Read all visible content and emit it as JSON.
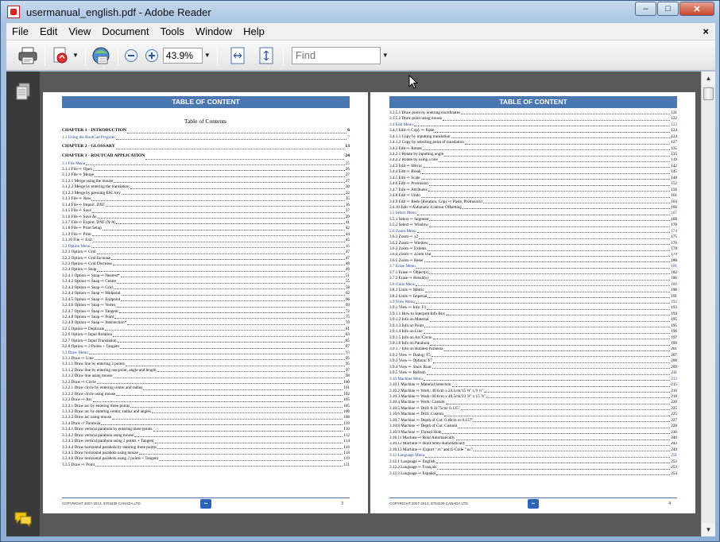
{
  "window": {
    "title": "usermanual_english.pdf - Adobe Reader"
  },
  "menubar": {
    "items": [
      "File",
      "Edit",
      "View",
      "Document",
      "Tools",
      "Window",
      "Help"
    ],
    "close_glyph": "×"
  },
  "window_controls": {
    "minimize": "–",
    "maximize": "□",
    "close": "✕"
  },
  "toolbar": {
    "zoom_value": "43.9%",
    "find_placeholder": "Find",
    "icons": [
      "print-icon",
      "create-pdf-icon",
      "collaborate-icon",
      "zoom-out-icon",
      "zoom-in-icon",
      "fit-page-icon",
      "fit-width-icon"
    ]
  },
  "left_page": {
    "header": "TABLE OF CONTENT",
    "title": "Table of Contents",
    "footer_text": "COPYRIGHT 2007-2013, 9704239 CANADA LTD.",
    "page_number": "3",
    "entries": [
      {
        "t": "CHAPTER 1 - INTRODUCTION",
        "p": "6",
        "k": "chapter"
      },
      {
        "t": "1.1 Using the RoutCad Program",
        "p": "7",
        "k": "sec"
      },
      {
        "t": "CHAPTER 2 - GLOSSARY",
        "p": "13",
        "k": "chapter"
      },
      {
        "t": "CHAPTER 3 - ROUTCAD APPLICATION",
        "p": "24",
        "k": "chapter"
      },
      {
        "t": "3.1 File Menu",
        "p": "25",
        "k": "sec"
      },
      {
        "t": "3.1.1 File ⇨ Open",
        "p": "26",
        "k": ""
      },
      {
        "t": "3.1.2 File ⇨ Merge",
        "p": "27",
        "k": ""
      },
      {
        "t": "3.1.2.1 Merge using the mouse",
        "p": "27",
        "k": ""
      },
      {
        "t": "3.1.2.2 Merge by entering the translation",
        "p": "30",
        "k": ""
      },
      {
        "t": "3.1.2.3 Merge by pressing ESC key",
        "p": "32",
        "k": ""
      },
      {
        "t": "3.1.3 File ⇨ New",
        "p": "35",
        "k": ""
      },
      {
        "t": "3.1.4 File ⇨ Import .DXF",
        "p": "36",
        "k": ""
      },
      {
        "t": "3.1.5 File ⇨ Save",
        "p": "37",
        "k": ""
      },
      {
        "t": "3.1.6 File ⇨ Save As",
        "p": "39",
        "k": ""
      },
      {
        "t": "3.1.7 File ⇨ Export .DXF (N/A)",
        "p": "41",
        "k": ""
      },
      {
        "t": "3.1.8 File ⇨ Print Setup",
        "p": "42",
        "k": ""
      },
      {
        "t": "3.1.9 File ⇨ Print",
        "p": "44",
        "k": ""
      },
      {
        "t": "3.1.10 File ⇨ Exit",
        "p": "45",
        "k": ""
      },
      {
        "t": "3.2 Option Menu",
        "p": "46",
        "k": "sec"
      },
      {
        "t": "3.2.1 Option ⇨ Grid",
        "p": "47",
        "k": ""
      },
      {
        "t": "3.2.2 Option ⇨ Grid Increase",
        "p": "47",
        "k": ""
      },
      {
        "t": "3.2.3 Option ⇨ Grid Decrease",
        "p": "48",
        "k": ""
      },
      {
        "t": "3.2.4 Option ⇨ Snap",
        "p": "49",
        "k": ""
      },
      {
        "t": "3.2.4.1 Option ⇨ Snap ⇨ Nearest*",
        "p": "51",
        "k": ""
      },
      {
        "t": "3.2.4.2 Option ⇨ Snap ⇨ Centre",
        "p": "55",
        "k": ""
      },
      {
        "t": "3.2.4.3 Option ⇨ Snap ⇨ Grid",
        "p": "58",
        "k": ""
      },
      {
        "t": "3.2.4.4 Option ⇨ Snap ⇨ Midpoint",
        "p": "62",
        "k": ""
      },
      {
        "t": "3.2.4.5 Option ⇨ Snap ⇨ Endpoint",
        "p": "66",
        "k": ""
      },
      {
        "t": "3.2.4.6 Option ⇨ Snap ⇨ Vertex",
        "p": "69",
        "k": ""
      },
      {
        "t": "3.2.4.7 Option ⇨ Snap ⇨ Tangent",
        "p": "72",
        "k": ""
      },
      {
        "t": "3.2.4.8 Option ⇨ Snap ⇨ Point",
        "p": "75",
        "k": ""
      },
      {
        "t": "3.2.4.9 Option ⇨ Snap ⇨ Intersection*",
        "p": "78",
        "k": ""
      },
      {
        "t": "3.2.5 Option ⇨ Duplicate",
        "p": "81",
        "k": ""
      },
      {
        "t": "3.2.6 Option ⇨ Input Rotation",
        "p": "83",
        "k": ""
      },
      {
        "t": "3.2.7 Option ⇨ Input Translation",
        "p": "85",
        "k": ""
      },
      {
        "t": "3.2.8 Option ⇨ 2 Points + Tangent",
        "p": "87",
        "k": ""
      },
      {
        "t": "3.3 Draw Menu",
        "p": "93",
        "k": "sec"
      },
      {
        "t": "3.3.1 Draw ⇨ Line",
        "p": "95",
        "k": ""
      },
      {
        "t": "3.3.1.1 Draw line by entering 2 points",
        "p": "95",
        "k": ""
      },
      {
        "t": "3.3.1.2 Draw line by entering one point, angle and length",
        "p": "97",
        "k": ""
      },
      {
        "t": "3.3.1.3 Draw line using mouse",
        "p": "98",
        "k": ""
      },
      {
        "t": "3.3.2 Draw ⇨ Circle",
        "p": "100",
        "k": ""
      },
      {
        "t": "3.3.2.1 Draw circle by entering center and radius",
        "p": "101",
        "k": ""
      },
      {
        "t": "3.3.2.2 Draw circle using mouse",
        "p": "102",
        "k": ""
      },
      {
        "t": "3.3.3 Draw ⇨ Arc",
        "p": "105",
        "k": ""
      },
      {
        "t": "3.3.3.1 Draw arc by entering three points",
        "p": "105",
        "k": ""
      },
      {
        "t": "3.3.3.2 Draw arc by entering center, radius and angles",
        "p": "106",
        "k": ""
      },
      {
        "t": "3.3.3.3 Draw arc using mouse",
        "p": "108",
        "k": ""
      },
      {
        "t": "3.3.4 Draw ⇨ Parabola",
        "p": "110",
        "k": ""
      },
      {
        "t": "3.3.4.1 Draw vertical parabola by entering three points",
        "p": "110",
        "k": ""
      },
      {
        "t": "3.3.4.2 Draw vertical parabola using mouse",
        "p": "112",
        "k": ""
      },
      {
        "t": "3.3.4.3 Draw vertical parabola using 2 points + Tangent",
        "p": "114",
        "k": ""
      },
      {
        "t": "3.3.4.4 Draw horizontal parabola by entering three points",
        "p": "116",
        "k": ""
      },
      {
        "t": "3.3.4.5 Draw horizontal parabola using mouse",
        "p": "118",
        "k": ""
      },
      {
        "t": "3.3.4.6 Draw horizontal parabola using 2 points + Tangent",
        "p": "119",
        "k": ""
      },
      {
        "t": "3.3.5 Draw ⇨ Point",
        "p": "121",
        "k": ""
      }
    ]
  },
  "right_page": {
    "header": "TABLE OF CONTENT",
    "footer_text": "COPYRIGHT 2007-2013, 9704239 CANADA LTD.",
    "page_number": "4",
    "entries": [
      {
        "t": "3.3.5.1 Draw point by entering coordinates",
        "p": "121",
        "k": ""
      },
      {
        "t": "3.3.5.2 Draw point using mouse",
        "p": "122",
        "k": ""
      },
      {
        "t": "3.4 Edit Menu",
        "p": "123",
        "k": "sec"
      },
      {
        "t": "3.4.1 Edit ⇨ Copy ⇨ Paste",
        "p": "124",
        "k": ""
      },
      {
        "t": "3.4.1.1 Copy by inputting translation",
        "p": "124",
        "k": ""
      },
      {
        "t": "3.4.1.2 Copy by selecting point of translation",
        "p": "127",
        "k": ""
      },
      {
        "t": "3.4.2 Edit ⇨ Rotate",
        "p": "135",
        "k": ""
      },
      {
        "t": "3.4.2.1 Rotate by inputting angle",
        "p": "135",
        "k": ""
      },
      {
        "t": "3.4.2.2 Rotate by using a line",
        "p": "139",
        "k": ""
      },
      {
        "t": "3.4.3 Edit ⇨ Mirror",
        "p": "142",
        "k": ""
      },
      {
        "t": "3.4.4 Edit ⇨ Break",
        "p": "145",
        "k": ""
      },
      {
        "t": "3.4.5 Edit ⇨ Scale",
        "p": "148",
        "k": ""
      },
      {
        "t": "3.4.6 Edit ⇨ Protrusion",
        "p": "152",
        "k": ""
      },
      {
        "t": "3.4.7 Edit ⇨ Attributes",
        "p": "156",
        "k": ""
      },
      {
        "t": "3.4.8 Edit ⇨ Undo",
        "p": "161",
        "k": ""
      },
      {
        "t": "3.4.9 Edit ⇨ Redo (Rotation, Copy ⇨ Paste, Protrusion)",
        "p": "163",
        "k": ""
      },
      {
        "t": "3.4.10 Edit ⇨Automatic Contour Offsetting",
        "p": "166",
        "k": ""
      },
      {
        "t": "3.5 Select Menu",
        "p": "167",
        "k": "sec"
      },
      {
        "t": "3.5.1 Select ⇨ Segment",
        "p": "168",
        "k": ""
      },
      {
        "t": "3.5.2 Select ⇨ Window",
        "p": "170",
        "k": ""
      },
      {
        "t": "3.6 Zoom Menu",
        "p": "174",
        "k": "sec"
      },
      {
        "t": "3.6.1 Zoom ⇨ x2",
        "p": "175",
        "k": ""
      },
      {
        "t": "3.6.2 Zoom ⇨ Window",
        "p": "176",
        "k": ""
      },
      {
        "t": "3.6.3 Zoom ⇨ Extents",
        "p": "178",
        "k": ""
      },
      {
        "t": "3.6.4 Zoom ⇨ Zoom Out",
        "p": "179",
        "k": ""
      },
      {
        "t": "3.6.5 Zoom ⇨ Reset",
        "p": "180",
        "k": ""
      },
      {
        "t": "3.7 Erase Menu",
        "p": "181",
        "k": "sec"
      },
      {
        "t": "3.7.1 Erase ⇨ Object(s)",
        "p": "182",
        "k": ""
      },
      {
        "t": "3.7.2 Erase ⇨ Result(s)",
        "p": "186",
        "k": ""
      },
      {
        "t": "3.8 Units Menu",
        "p": "189",
        "k": "sec"
      },
      {
        "t": "3.8.1 Units ⇨ Metric",
        "p": "190",
        "k": ""
      },
      {
        "t": "3.8.2 Units ⇨ Imperial",
        "p": "191",
        "k": ""
      },
      {
        "t": "3.9 View Menu",
        "p": "192",
        "k": "sec"
      },
      {
        "t": "3.9.1 View ⇨ Info: F1",
        "p": "193",
        "k": ""
      },
      {
        "t": "3.9.1.1 How to Interpret Info Box",
        "p": "194",
        "k": ""
      },
      {
        "t": "3.9.1.2 Info on Material",
        "p": "195",
        "k": ""
      },
      {
        "t": "3.9.1.3 Info on Point",
        "p": "195",
        "k": ""
      },
      {
        "t": "3.9.1.4 Info on Line",
        "p": "196",
        "k": ""
      },
      {
        "t": "3.9.1.5 Info on Arc/Circle",
        "p": "197",
        "k": ""
      },
      {
        "t": "3.9.1.6 Info on Parabola",
        "p": "199",
        "k": ""
      },
      {
        "t": "3.9.1.7 Info on Rotated Parabola",
        "p": "201",
        "k": ""
      },
      {
        "t": "3.9.2 View ⇨ Dialog: F5",
        "p": "207",
        "k": ""
      },
      {
        "t": "3.9.3 View ⇨ Options: F7",
        "p": "208",
        "k": ""
      },
      {
        "t": "3.9.4 View ⇨ Show Rout",
        "p": "209",
        "k": ""
      },
      {
        "t": "3.9.5 View ⇨ Refresh",
        "p": "211",
        "k": ""
      },
      {
        "t": "3.10 Machine Menu",
        "p": "213",
        "k": "sec"
      },
      {
        "t": "3.10.1 Machine ⇨ Material Selection",
        "p": "215",
        "k": ""
      },
      {
        "t": "3.10.2 Machine ⇨ Work: 40.6cm x 24.1cm/15 ⅝\" x 9 ½\"",
        "p": "216",
        "k": ""
      },
      {
        "t": "3.10.3 Machine ⇨ Work: 60.6cm x 40.5cm/23 ⅞\" x 15 ⅞\"",
        "p": "218",
        "k": ""
      },
      {
        "t": "3.10.4 Machine ⇨ Work: Custom",
        "p": "220",
        "k": ""
      },
      {
        "t": "3.10.5 Machine ⇨ Drill: 0.3175cm/ 0.125\"",
        "p": "225",
        "k": ""
      },
      {
        "t": "3.10.6 Machine ⇨ Drill: Custom",
        "p": "225",
        "k": ""
      },
      {
        "t": "3.10.7 Machine ⇨ Depth of Cut: 0.40cm or 0.157\"",
        "p": "227",
        "k": ""
      },
      {
        "t": "3.10.8 Machine ⇨ Depth of Cut: Custom",
        "p": "228",
        "k": ""
      },
      {
        "t": "3.10.9 Machine ⇨ Thread Hole",
        "p": "230",
        "k": ""
      },
      {
        "t": "3.10.11 Machine ⇨ Rout Automatically",
        "p": "240",
        "k": ""
      },
      {
        "t": "3.10.12 Machine ⇨ Rout Semi-Automatically",
        "p": "243",
        "k": ""
      },
      {
        "t": "3.10.13 Machine ⇨ Export \".rs\" and G-Code \".nc\"",
        "p": "249",
        "k": ""
      },
      {
        "t": "3.12 Language Menu",
        "p": "251",
        "k": "sec"
      },
      {
        "t": "3.12.1 Language ⇨ English",
        "p": "252",
        "k": ""
      },
      {
        "t": "3.12.2 Language ⇨ Français",
        "p": "253",
        "k": ""
      },
      {
        "t": "3.12.3 Language ⇨ Español",
        "p": "254",
        "k": ""
      }
    ]
  }
}
